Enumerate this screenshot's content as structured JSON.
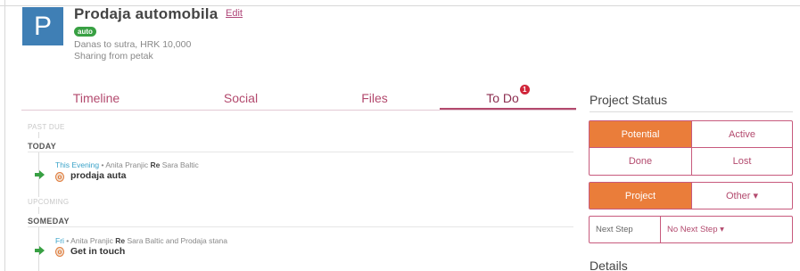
{
  "project": {
    "avatar_letter": "P",
    "avatar_color": "#3f7fb5",
    "title": "Prodaja automobila",
    "edit_label": "Edit",
    "tag": "auto",
    "meta1": "Danas to sutra, HRK 10,000",
    "meta2": "Sharing from petak"
  },
  "tabs": [
    {
      "label": "Timeline"
    },
    {
      "label": "Social"
    },
    {
      "label": "Files"
    },
    {
      "label": "To Do",
      "badge": "1",
      "active": true
    }
  ],
  "todo": {
    "past_due_label": "PAST DUE",
    "today_label": "TODAY",
    "upcoming_label": "UPCOMING",
    "someday_label": "SOMEDAY",
    "tasks": [
      {
        "when": "This Evening",
        "sep": " • Anita Pranjic ",
        "re_label": "Re",
        "re_target": " Sara Baltic",
        "title": "prodaja auta",
        "icon": "task-icon"
      },
      {
        "when": "Fri",
        "sep": " • Anita Pranjic ",
        "re_label": "Re",
        "re_target": " Sara Baltic and Prodaja stana",
        "title": "Get in touch",
        "icon": "task-icon"
      }
    ]
  },
  "status_panel": {
    "title": "Project Status",
    "status_options": [
      "Potential",
      "Active",
      "Done",
      "Lost"
    ],
    "selected_status": "Potential",
    "type_options": [
      "Project",
      "Other ▾"
    ],
    "selected_type": "Project",
    "next_step_label": "Next Step",
    "next_step_value": "No Next Step ▾",
    "details_title": "Details"
  },
  "colors": {
    "accent": "#b34a6e",
    "selected": "#ea7d3a",
    "tag_green": "#38a043",
    "when_blue": "#3aa3c9",
    "arrow_green": "#38a043"
  }
}
